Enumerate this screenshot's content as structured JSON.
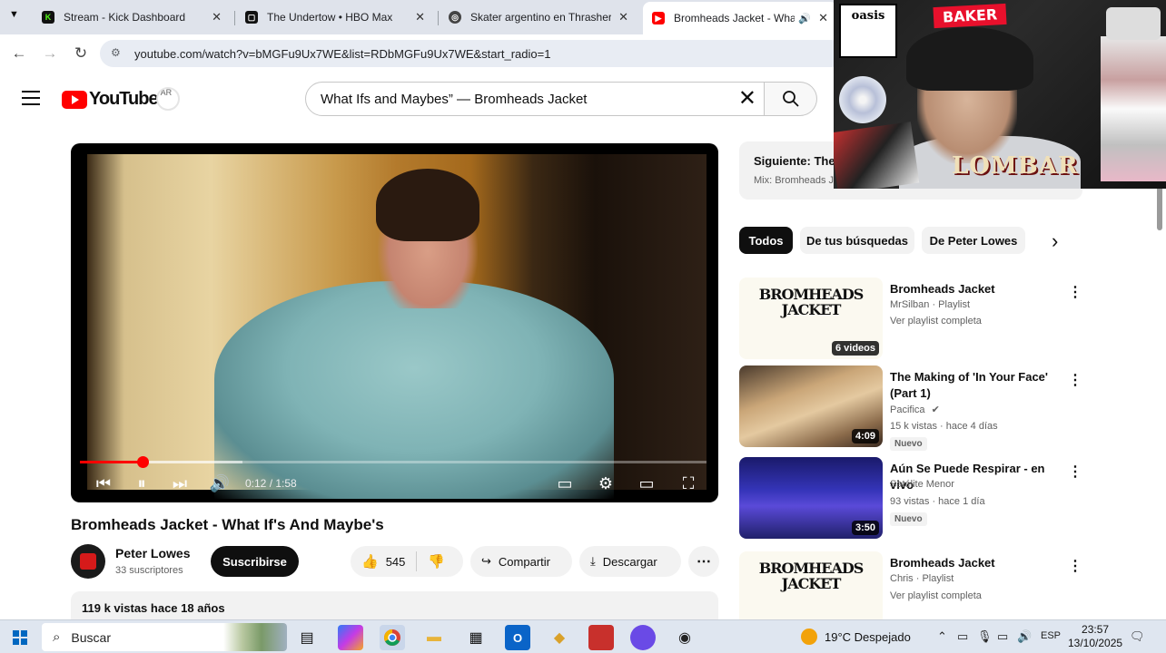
{
  "browser": {
    "tabs": [
      {
        "title": "Stream - Kick Dashboard",
        "favicon": "kick-icon",
        "favicon_color": "#53fc18"
      },
      {
        "title": "The Undertow • HBO Max",
        "favicon": "hbo-icon",
        "favicon_color": "#111111"
      },
      {
        "title": "Skater argentino en Thrasher",
        "favicon": "thrasher-icon",
        "favicon_color": "#333333"
      },
      {
        "title": "Bromheads Jacket - What If",
        "favicon": "youtube-icon",
        "favicon_color": "#ff0000",
        "active": true
      }
    ],
    "url": "youtube.com/watch?v=bMGFu9Ux7WE&list=RDbMGFu9Ux7WE&start_radio=1"
  },
  "youtube": {
    "logo_text": "YouTube",
    "country_code": "AR",
    "search_value": "What Ifs and Maybes” — Bromheads Jacket"
  },
  "player": {
    "time": "0:12 / 1:58",
    "progress_fraction": 0.1,
    "buffer_fraction": 0.26
  },
  "video": {
    "title": "Bromheads Jacket - What If's And Maybe's",
    "channel": "Peter Lowes",
    "subscribers": "33 suscriptores",
    "subscribe_label": "Suscribirse",
    "likes": "545",
    "share_label": "Compartir",
    "download_label": "Descargar",
    "views_date": "119 k vistas  hace 18 años"
  },
  "up_next": {
    "label": "Siguiente: The S",
    "mix": "Mix: Bromheads Ja"
  },
  "chips": [
    "Todos",
    "De tus búsquedas",
    "De Peter Lowes"
  ],
  "recommendations": [
    {
      "title": "Bromheads Jacket",
      "line1": "MrSilban · Playlist",
      "line2": "Ver playlist completa",
      "duration": "6 videos",
      "thumb_text": "BROMHEADS JACKET",
      "badge": ""
    },
    {
      "title": "The Making of 'In Your Face' (Part 1)",
      "line1": "Pacifica",
      "line2": "15 k vistas · hace 4 días",
      "duration": "4:09",
      "thumb_text": "",
      "badge": "Nuevo"
    },
    {
      "title": "Aún Se Puede Respirar - en vivo",
      "line1": "Satélite Menor",
      "line2": "93 vistas · hace 1 día",
      "duration": "3:50",
      "thumb_text": "",
      "badge": "Nuevo"
    },
    {
      "title": "Bromheads Jacket",
      "line1": "Chris · Playlist",
      "line2": "Ver playlist completa",
      "duration": "",
      "thumb_text": "BROMHEADS JACKET",
      "badge": ""
    }
  ],
  "webcam": {
    "sticker_oasis": "oasis",
    "sticker_baker": "BAKER",
    "sticker_lombar": "LOMBAR"
  },
  "taskbar": {
    "search_placeholder": "Buscar",
    "weather": "19°C  Despejado",
    "language": "ESP",
    "time": "23:57",
    "date": "13/10/2025"
  }
}
